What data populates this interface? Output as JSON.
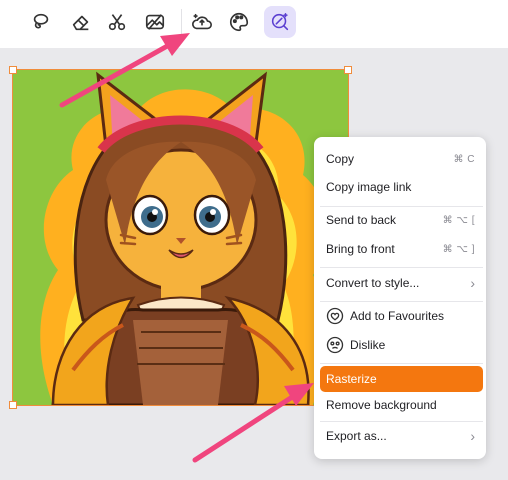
{
  "toolbar": {
    "tools": [
      {
        "icon": "lasso-icon"
      },
      {
        "icon": "eraser-icon"
      },
      {
        "icon": "scissors-icon"
      },
      {
        "icon": "image-icon"
      },
      {
        "icon": "cloud-upscale-icon"
      },
      {
        "icon": "palette-icon"
      },
      {
        "icon": "magic-icon",
        "active": true
      }
    ]
  },
  "canvas": {
    "image": "cartoon-cat-portrait"
  },
  "context_menu": {
    "items": [
      {
        "label": "Copy",
        "shortcut": "⌘ C"
      },
      {
        "label": "Copy image link"
      },
      {
        "label": "Send to back",
        "shortcut": "⌘ ⌥ ["
      },
      {
        "label": "Bring to front",
        "shortcut": "⌘ ⌥ ]"
      },
      {
        "label": "Convert to style...",
        "submenu": true
      },
      {
        "label": "Add to Favourites",
        "icon": "heart-icon"
      },
      {
        "label": "Dislike",
        "icon": "dislike-icon"
      },
      {
        "label": "Rasterize",
        "highlighted": true
      },
      {
        "label": "Remove background"
      },
      {
        "label": "Export as...",
        "submenu": true
      }
    ],
    "highlight_color": "#f4770f"
  },
  "annotations": {
    "arrow_color": "#f0457e"
  }
}
